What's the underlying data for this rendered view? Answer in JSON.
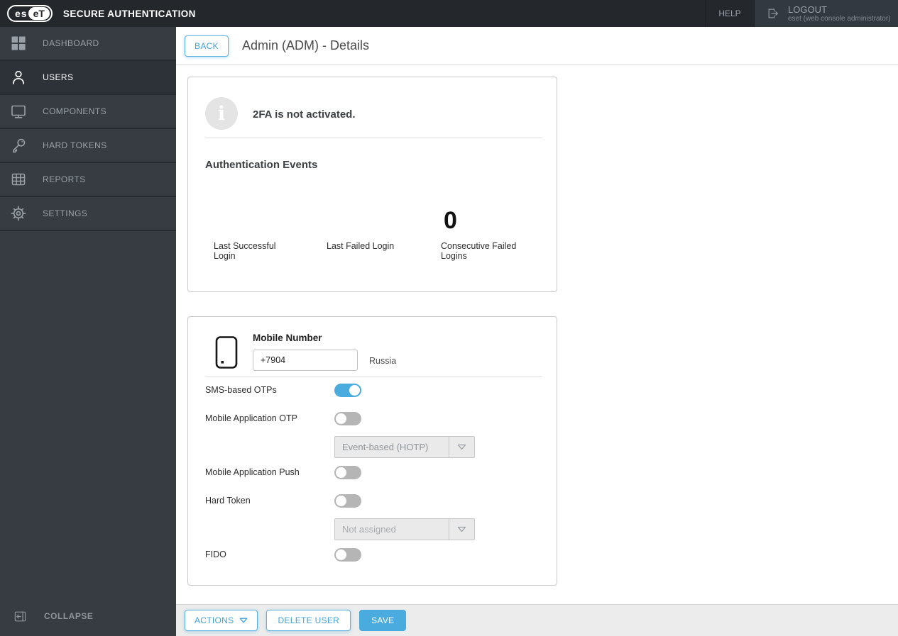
{
  "colors": {
    "accent_blue": "#4aabdf",
    "topbar_bg": "#24282d",
    "sidebar_bg": "#373c42",
    "toggle_off_gray": "#b5b5b5"
  },
  "topbar": {
    "logo_left": "es",
    "logo_right": "eT",
    "product_name": "SECURE AUTHENTICATION",
    "help_label": "HELP",
    "logout_label": "LOGOUT",
    "logout_user": "eset (web console administrator)"
  },
  "sidebar": {
    "items": [
      {
        "label": "DASHBOARD",
        "icon": "dashboard-grid-icon",
        "active": false
      },
      {
        "label": "USERS",
        "icon": "user-icon",
        "active": true
      },
      {
        "label": "COMPONENTS",
        "icon": "monitor-icon",
        "active": false
      },
      {
        "label": "HARD TOKENS",
        "icon": "key-icon",
        "active": false
      },
      {
        "label": "REPORTS",
        "icon": "report-grid-icon",
        "active": false
      },
      {
        "label": "SETTINGS",
        "icon": "gear-icon",
        "active": false
      }
    ],
    "collapse_label": "COLLAPSE"
  },
  "header": {
    "back_label": "BACK",
    "title": "Admin (ADM) - Details"
  },
  "status_card": {
    "info_icon_glyph": "i",
    "info_message": "2FA is not activated.",
    "section_title": "Authentication Events",
    "stats": [
      {
        "label": "Last Successful Login",
        "value": ""
      },
      {
        "label": "Last Failed Login",
        "value": ""
      },
      {
        "label": "Consecutive Failed Logins",
        "value": "0"
      }
    ]
  },
  "mobile_card": {
    "mobile_number_label": "Mobile Number",
    "mobile_number_value": "+7904",
    "country": "Russia",
    "toggles": {
      "sms": {
        "label": "SMS-based OTPs",
        "enabled": true
      },
      "mobile_app_otp": {
        "label": "Mobile Application OTP",
        "enabled": false
      },
      "mobile_app_push": {
        "label": "Mobile Application Push",
        "enabled": false
      },
      "hard_token": {
        "label": "Hard Token",
        "enabled": false
      },
      "fido": {
        "label": "FIDO",
        "enabled": false
      }
    },
    "otp_type_dropdown": {
      "value": "Event-based (HOTP)",
      "disabled": true
    },
    "hard_token_dropdown": {
      "value": "Not assigned",
      "disabled": true
    }
  },
  "footer": {
    "actions_label": "ACTIONS",
    "delete_user_label": "DELETE USER",
    "save_label": "SAVE"
  }
}
